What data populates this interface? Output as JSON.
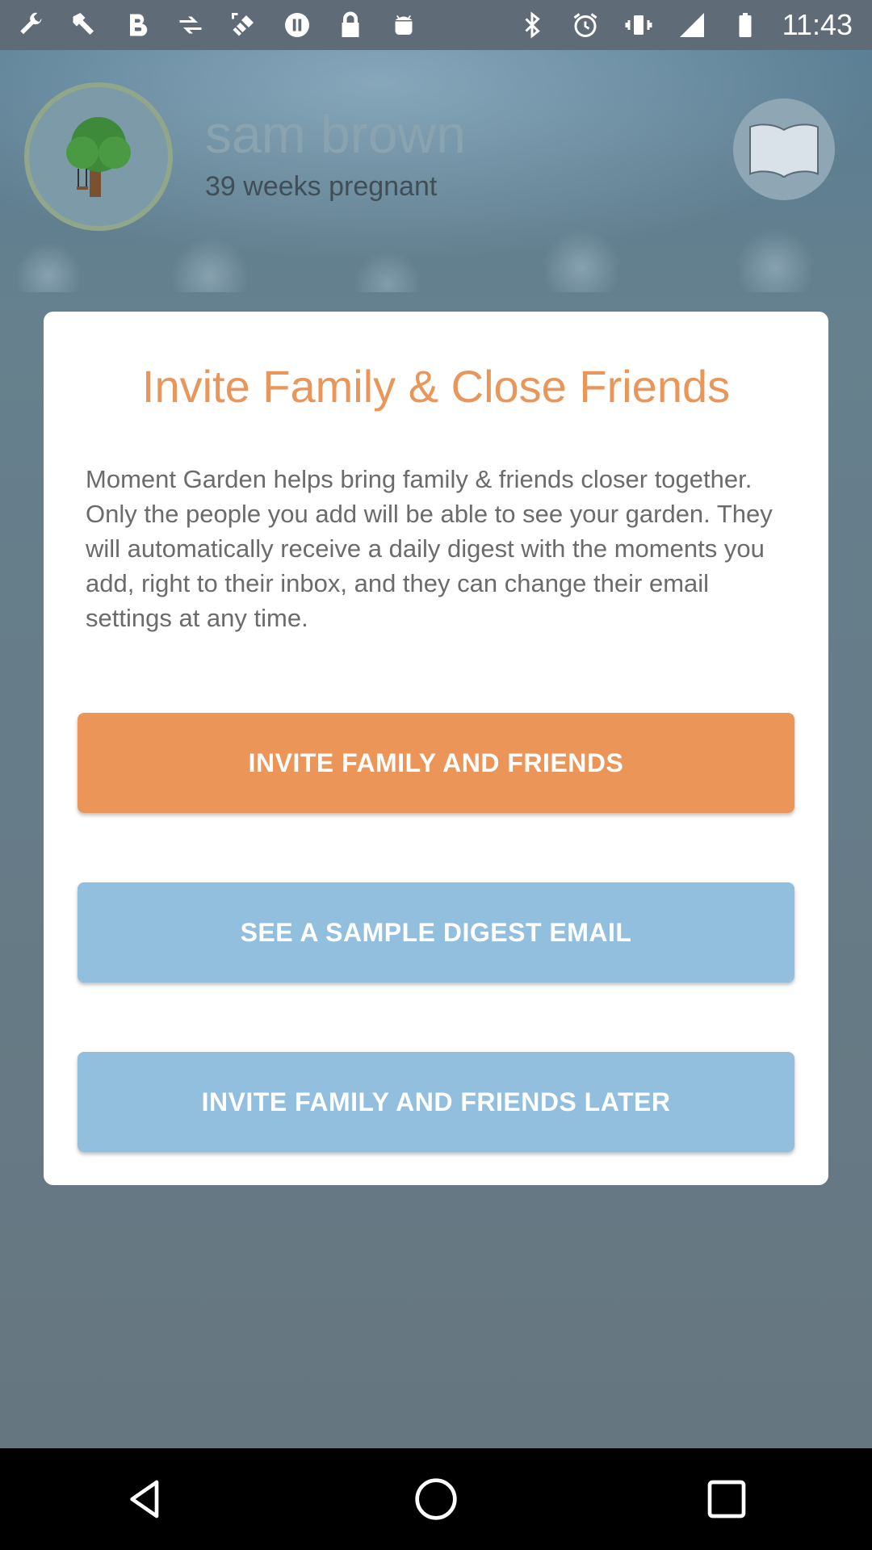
{
  "status_bar": {
    "time": "11:43",
    "left_icons": [
      "wrench-icon",
      "hammer-icon",
      "bold-b-icon",
      "fast-forward-icon",
      "fake-gps-icon",
      "pause-circle-icon",
      "lock-icon",
      "android-icon"
    ],
    "right_icons": [
      "bluetooth-icon",
      "alarm-icon",
      "vibrate-icon",
      "signal-icon",
      "battery-icon"
    ]
  },
  "profile": {
    "name": "sam brown",
    "subtitle": "39 weeks pregnant"
  },
  "dialog": {
    "title": "Invite Family & Close Friends",
    "body": "Moment Garden helps bring family & friends closer together. Only the people you add will be able to see your garden. They will automatically receive a daily digest with the moments you add, right to their inbox, and they can change their email settings at any time.",
    "buttons": {
      "invite": "INVITE FAMILY AND FRIENDS",
      "sample": "SEE A SAMPLE DIGEST EMAIL",
      "later": "INVITE FAMILY AND FRIENDS LATER"
    }
  },
  "colors": {
    "accent_orange": "#eb9658",
    "title_orange": "#e89659",
    "button_blue": "#92bfde",
    "status_bar": "#5f6b76"
  },
  "nav_bar": {
    "icons": [
      "back-icon",
      "home-icon",
      "recents-icon"
    ]
  }
}
